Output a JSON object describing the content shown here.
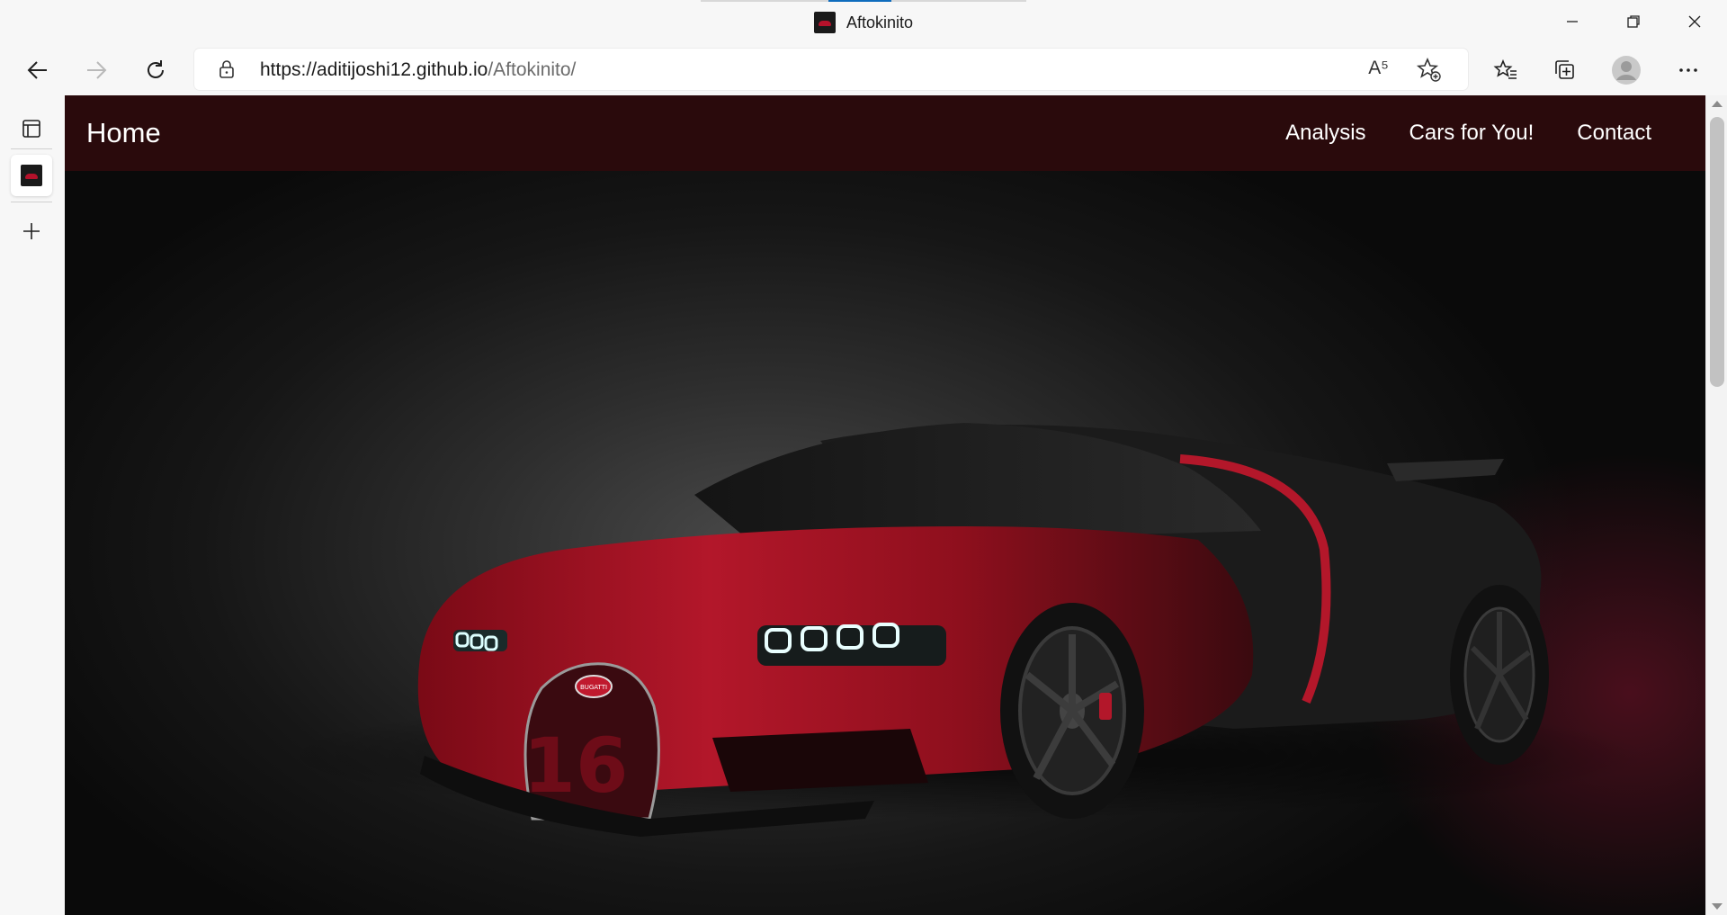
{
  "browser": {
    "tab_title": "Aftokinito",
    "url_host": "https://aditijoshi12.github.io",
    "url_path": "/Aftokinito/",
    "read_aloud_label": "A⁵",
    "icons": {
      "back": "back-arrow-icon",
      "forward": "forward-arrow-icon",
      "refresh": "refresh-icon",
      "lock": "lock-icon",
      "favorites": "favorites-icon",
      "collections": "collections-icon",
      "profile": "profile-icon",
      "more": "more-icon",
      "minimize": "minimize-icon",
      "restore": "restore-icon",
      "close": "close-icon"
    }
  },
  "site": {
    "brand": "Home",
    "nav": [
      {
        "label": "Analysis"
      },
      {
        "label": "Cars for You!"
      },
      {
        "label": "Contact"
      }
    ],
    "colors": {
      "navbar": "#2a0a0c",
      "accent": "#b5122b"
    },
    "hero_badge": "BUGATTI",
    "hero_number": "16"
  }
}
